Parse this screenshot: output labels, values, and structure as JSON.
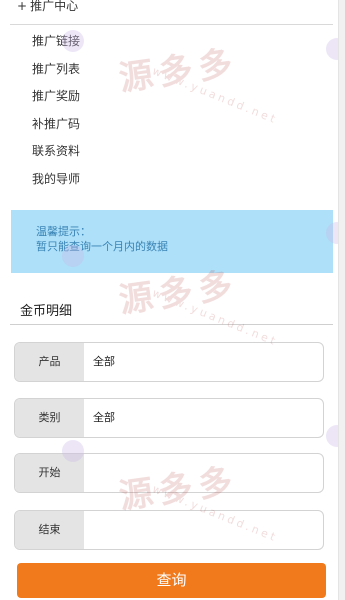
{
  "promo": {
    "title": "推广中心",
    "items": [
      "推广链接",
      "推广列表",
      "推广奖励",
      "补推广码",
      "联系资料",
      "我的导师"
    ]
  },
  "notice": {
    "line1": "温馨提示：",
    "line2": "暂只能查询一个月内的数据"
  },
  "coins": {
    "title": "金币明细"
  },
  "filters": {
    "product_label": "产品",
    "product_value": "全部",
    "category_label": "类别",
    "category_value": "全部",
    "start_label": "开始",
    "end_label": "结束"
  },
  "search_button": "查询",
  "watermark": {
    "text": "源多多",
    "url": "www.yuandd.net"
  },
  "colors": {
    "accent": "#f07a1c",
    "notice_bg": "#aee0f9",
    "notice_text": "#3a84b5"
  }
}
